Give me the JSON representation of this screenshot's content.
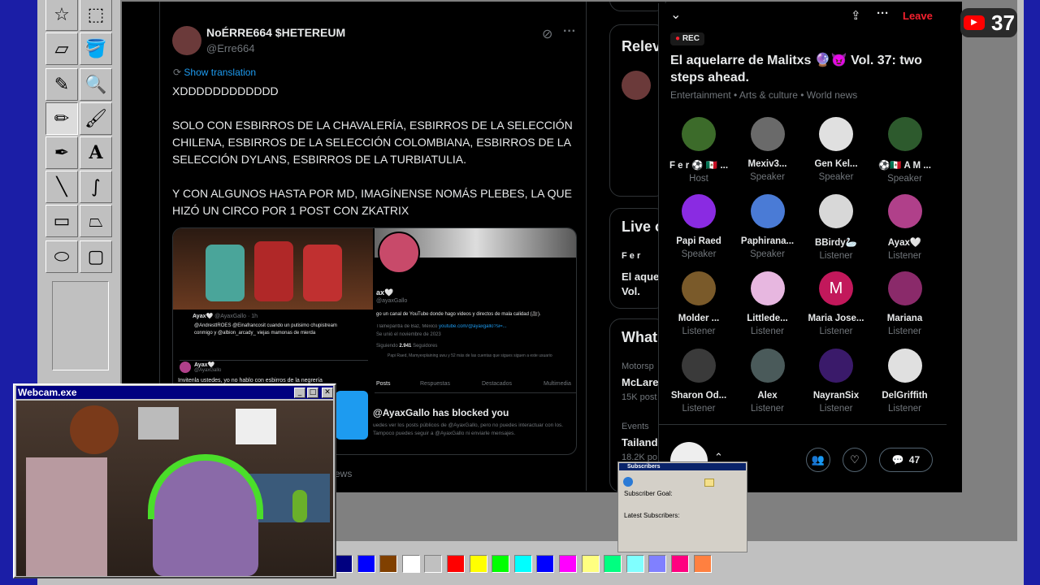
{
  "tweet": {
    "name": "NoÉRRE664 $HETEREUM",
    "handle": "@Erre664",
    "show_translation": "Show translation",
    "text": "XDDDDDDDDDDDD\n\nSOLO CON ESBIRROS DE LA CHAVALERÍA, ESBIRROS DE LA SELECCIÓN CHILENA, ESBIRROS DE LA SELECCIÓN COLOMBIANA, ESBIRROS DE LA SELECCIÓN DYLANS, ESBIRROS DE LA TURBIATULIA.\n\nY CON ALGUNOS HASTA POR MD, IMAGÍNENSE NOMÁS PLEBES, LA QUE HIZÓ UN CIRCO POR 1 POST CON ZKATRIX",
    "media": {
      "quote_name": "Ayax🤍",
      "quote_handle": "@AyaxGallo · 1h",
      "quote_text": "@AndrestIROES @Einafrancosit cuando un putisimo chupistream conmigo y @albion_arcady_ viejas mamonas de mierda",
      "quote2_name": "Ayax🤍",
      "quote2_handle": "@AyaxGallo",
      "quote2_text": "Invitenla ustedes, yo no hablo con esbirros de la negrería",
      "profile_name": "ax🤍",
      "profile_handle": "@ayaxGallo",
      "profile_bio": "go un canal de YouTube donde hago videos y directos de mala calidad (🎥).",
      "profile_loc": "Tlalnepantla de Baz, México",
      "profile_link": "youtube.com/@ayaxgallo?si=...",
      "profile_joined": "Se unió el noviembre de 2023",
      "following_label": "Siguiendo",
      "followers": "2.941",
      "followers_label": "Seguidores",
      "followed_by": "Papi Raed, Mamyexplaining uwu y 52 más de las cuentas que sigues siguen a este usuario",
      "tabs": [
        "Posts",
        "Respuestas",
        "Destacados",
        "Multimedia"
      ],
      "blocked_title": "@AyaxGallo has blocked you",
      "blocked_text": "uedes ver los posts públicos de @AyaxGallo, pero no puedes interactuar con los. Tampoco puedes seguir a @AyaxGallo ni enviarle mensajes.",
      "news_label": "ews"
    }
  },
  "right_col": {
    "relevant": "Relev",
    "live": "Live o",
    "live_user": "F e r",
    "live_title1": "El aque",
    "live_title2": "Vol.",
    "whats": "What",
    "t1_cat": "Motorsp",
    "t1_name": "McLare",
    "t1_posts": "15K post",
    "t2_cat": "Events",
    "t2_name": "Tailand",
    "t2_posts": "18.2K po"
  },
  "space": {
    "leave": "Leave",
    "rec": "REC",
    "title": "El aquelarre de Malitxs 🔮😈 Vol. 37: two steps ahead.",
    "categories": "Entertainment • Arts & culture • World news",
    "participants": [
      {
        "name": "F e r ⚽ 🇲🇽 ...",
        "role": "Host",
        "color": "#3c6b2a"
      },
      {
        "name": "Mexiv3...",
        "role": "Speaker",
        "color": "#6a6a6a"
      },
      {
        "name": "Gen Kel...",
        "role": "Speaker",
        "color": "#e0e0e0"
      },
      {
        "name": "⚽🇲🇽 A M ...",
        "role": "Speaker",
        "color": "#2d5a2d"
      },
      {
        "name": "Papi Raed",
        "role": "Speaker",
        "color": "#8a2be2"
      },
      {
        "name": "Paphirana...",
        "role": "Speaker",
        "color": "#4a7bd6"
      },
      {
        "name": "BBirdy🦢",
        "role": "Listener",
        "color": "#d8d8d8"
      },
      {
        "name": "Ayax🤍",
        "role": "Listener",
        "color": "#b0408a"
      },
      {
        "name": "Molder ...",
        "role": "Listener",
        "color": "#7a5a2a"
      },
      {
        "name": "Littlede...",
        "role": "Listener",
        "color": "#e7b7e0"
      },
      {
        "name": "Maria Jose...",
        "role": "Listener",
        "color": "#c2185b",
        "letter": "M"
      },
      {
        "name": "Mariana",
        "role": "Listener",
        "color": "#8a2a6a"
      },
      {
        "name": "Sharon Od...",
        "role": "Listener",
        "color": "#3a3a3a"
      },
      {
        "name": "Alex",
        "role": "Listener",
        "color": "#4a5a5a"
      },
      {
        "name": "NayranSix",
        "role": "Listener",
        "color": "#3a1a6a"
      },
      {
        "name": "DelGriffith",
        "role": "Listener",
        "color": "#e0e0e0"
      }
    ],
    "reply_count": "47"
  },
  "webcam": {
    "title": "Webcam.exe"
  },
  "subscribers": {
    "title": "Subscribers",
    "goal": "Subscriber Goal:",
    "latest": "Latest Subscribers:"
  },
  "yt": {
    "count": "37"
  },
  "palette": [
    "#000080",
    "#0000ff",
    "#804000",
    "#ffffff",
    "#c0c0c0",
    "#ff0000",
    "#ffff00",
    "#00ff00",
    "#00ffff",
    "#0000ff",
    "#ff00ff",
    "#ffff80",
    "#00ff80",
    "#80ffff",
    "#8080ff",
    "#ff0080",
    "#ff8040"
  ]
}
